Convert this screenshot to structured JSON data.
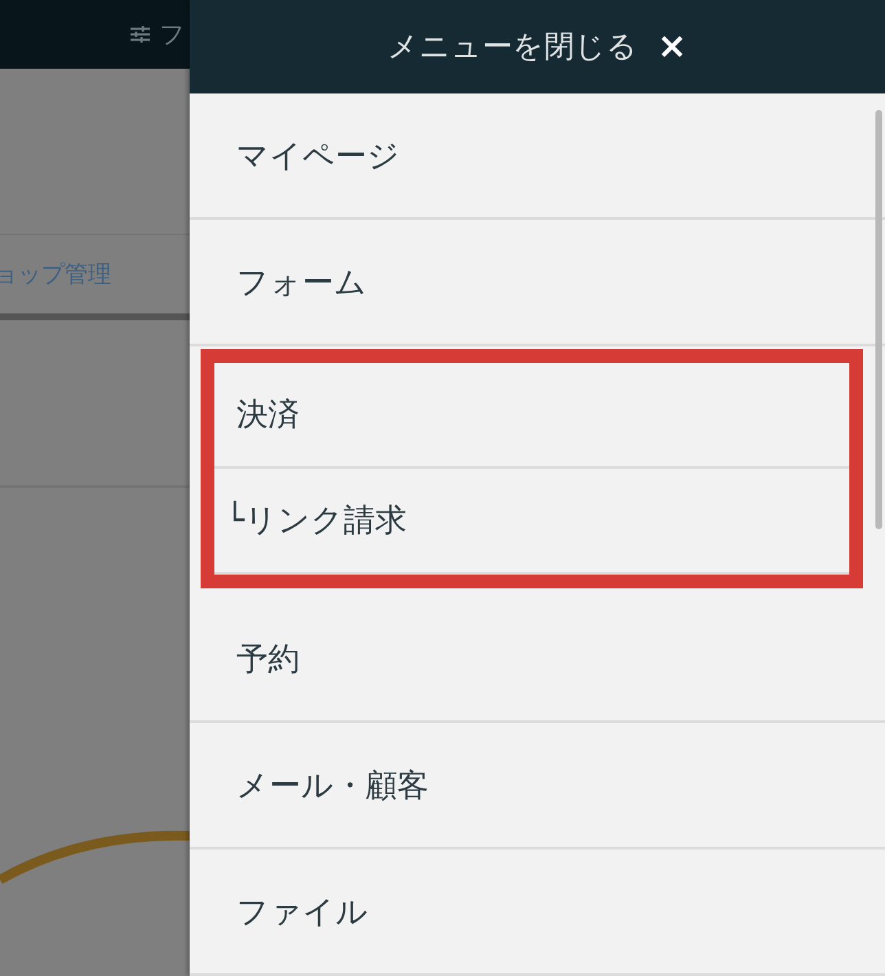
{
  "background": {
    "top_bar_text": "フ",
    "nav_text": "ョップ管理"
  },
  "drawer": {
    "close_label": "メニューを閉じる",
    "close_icon": "×",
    "items": [
      {
        "label": "マイページ",
        "kind": "item",
        "highlighted": false
      },
      {
        "label": "フォーム",
        "kind": "item",
        "highlighted": false
      },
      {
        "label": "決済",
        "kind": "item",
        "highlighted": true
      },
      {
        "label": "└リンク請求",
        "kind": "subitem",
        "highlighted": true
      },
      {
        "label": "予約",
        "kind": "item",
        "highlighted": false
      },
      {
        "label": "メール・顧客",
        "kind": "item",
        "highlighted": false
      },
      {
        "label": "ファイル",
        "kind": "item",
        "highlighted": false
      }
    ]
  }
}
